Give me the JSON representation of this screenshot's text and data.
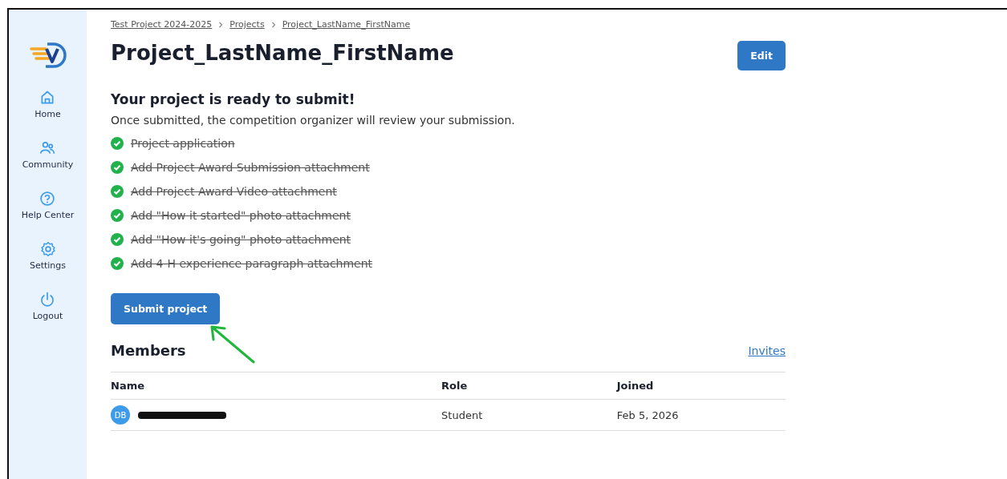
{
  "sidebar": {
    "items": [
      {
        "kind": "home",
        "label": "Home"
      },
      {
        "kind": "community",
        "label": "Community"
      },
      {
        "kind": "help",
        "label": "Help Center"
      },
      {
        "kind": "settings",
        "label": "Settings"
      },
      {
        "kind": "logout",
        "label": "Logout"
      }
    ]
  },
  "breadcrumbs": [
    "Test Project 2024-2025",
    "Projects",
    "Project_LastName_FirstName"
  ],
  "title": "Project_LastName_FirstName",
  "edit_button": "Edit",
  "ready": {
    "heading": "Your project is ready to submit!",
    "description": "Once submitted, the competition organizer will review your submission."
  },
  "checklist": [
    {
      "label": "Project application",
      "done": true
    },
    {
      "label": "Add Project Award Submission attachment",
      "done": true
    },
    {
      "label": "Add Project Award Video attachment",
      "done": true
    },
    {
      "label": "Add \"How it started\" photo attachment",
      "done": true
    },
    {
      "label": "Add \"How it's going\" photo attachment",
      "done": true
    },
    {
      "label": "Add 4-H experience paragraph attachment",
      "done": true
    }
  ],
  "submit_button": "Submit project",
  "members": {
    "heading": "Members",
    "invites_link": "Invites",
    "columns": [
      "Name",
      "Role",
      "Joined"
    ],
    "rows": [
      {
        "initials": "DB",
        "name_redacted": true,
        "role": "Student",
        "joined": "Feb 5, 2026"
      }
    ]
  }
}
